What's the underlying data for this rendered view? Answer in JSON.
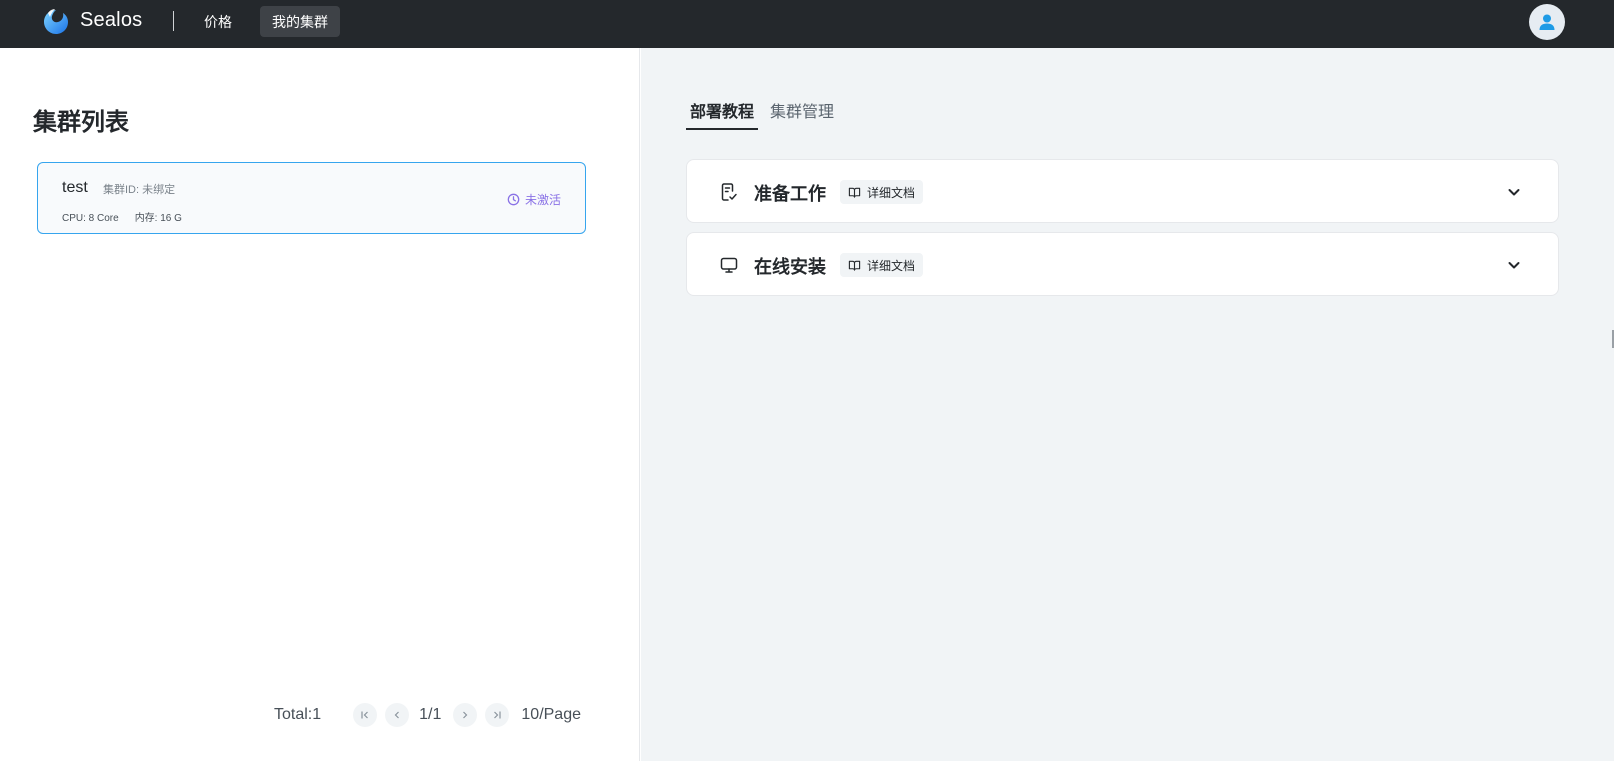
{
  "header": {
    "brand": "Sealos",
    "nav": {
      "price": "价格",
      "my_clusters": "我的集群"
    },
    "icons": {
      "logo": "sealos-logo-icon",
      "avatar": "user-avatar-icon"
    }
  },
  "cluster_list": {
    "title": "集群列表",
    "items": [
      {
        "name": "test",
        "id_label": "集群ID: 未绑定",
        "cpu": "CPU: 8 Core",
        "memory": "内存: 16 G",
        "status": "未激活",
        "status_icon": "clock-icon"
      }
    ],
    "pagination": {
      "total": "Total:1",
      "page": "1/1",
      "page_size": "10/Page"
    }
  },
  "tabs": [
    "部署教程",
    "集群管理"
  ],
  "sections": [
    {
      "title": "准备工作",
      "badge": "详细文档",
      "icon": "checklist-icon"
    },
    {
      "title": "在线安装",
      "badge": "详细文档",
      "icon": "monitor-icon"
    }
  ],
  "colors": {
    "topbar": "#24282c",
    "selected_border": "#36a5ee",
    "status": "#8a72e6",
    "right_bg": "#f1f4f6"
  }
}
